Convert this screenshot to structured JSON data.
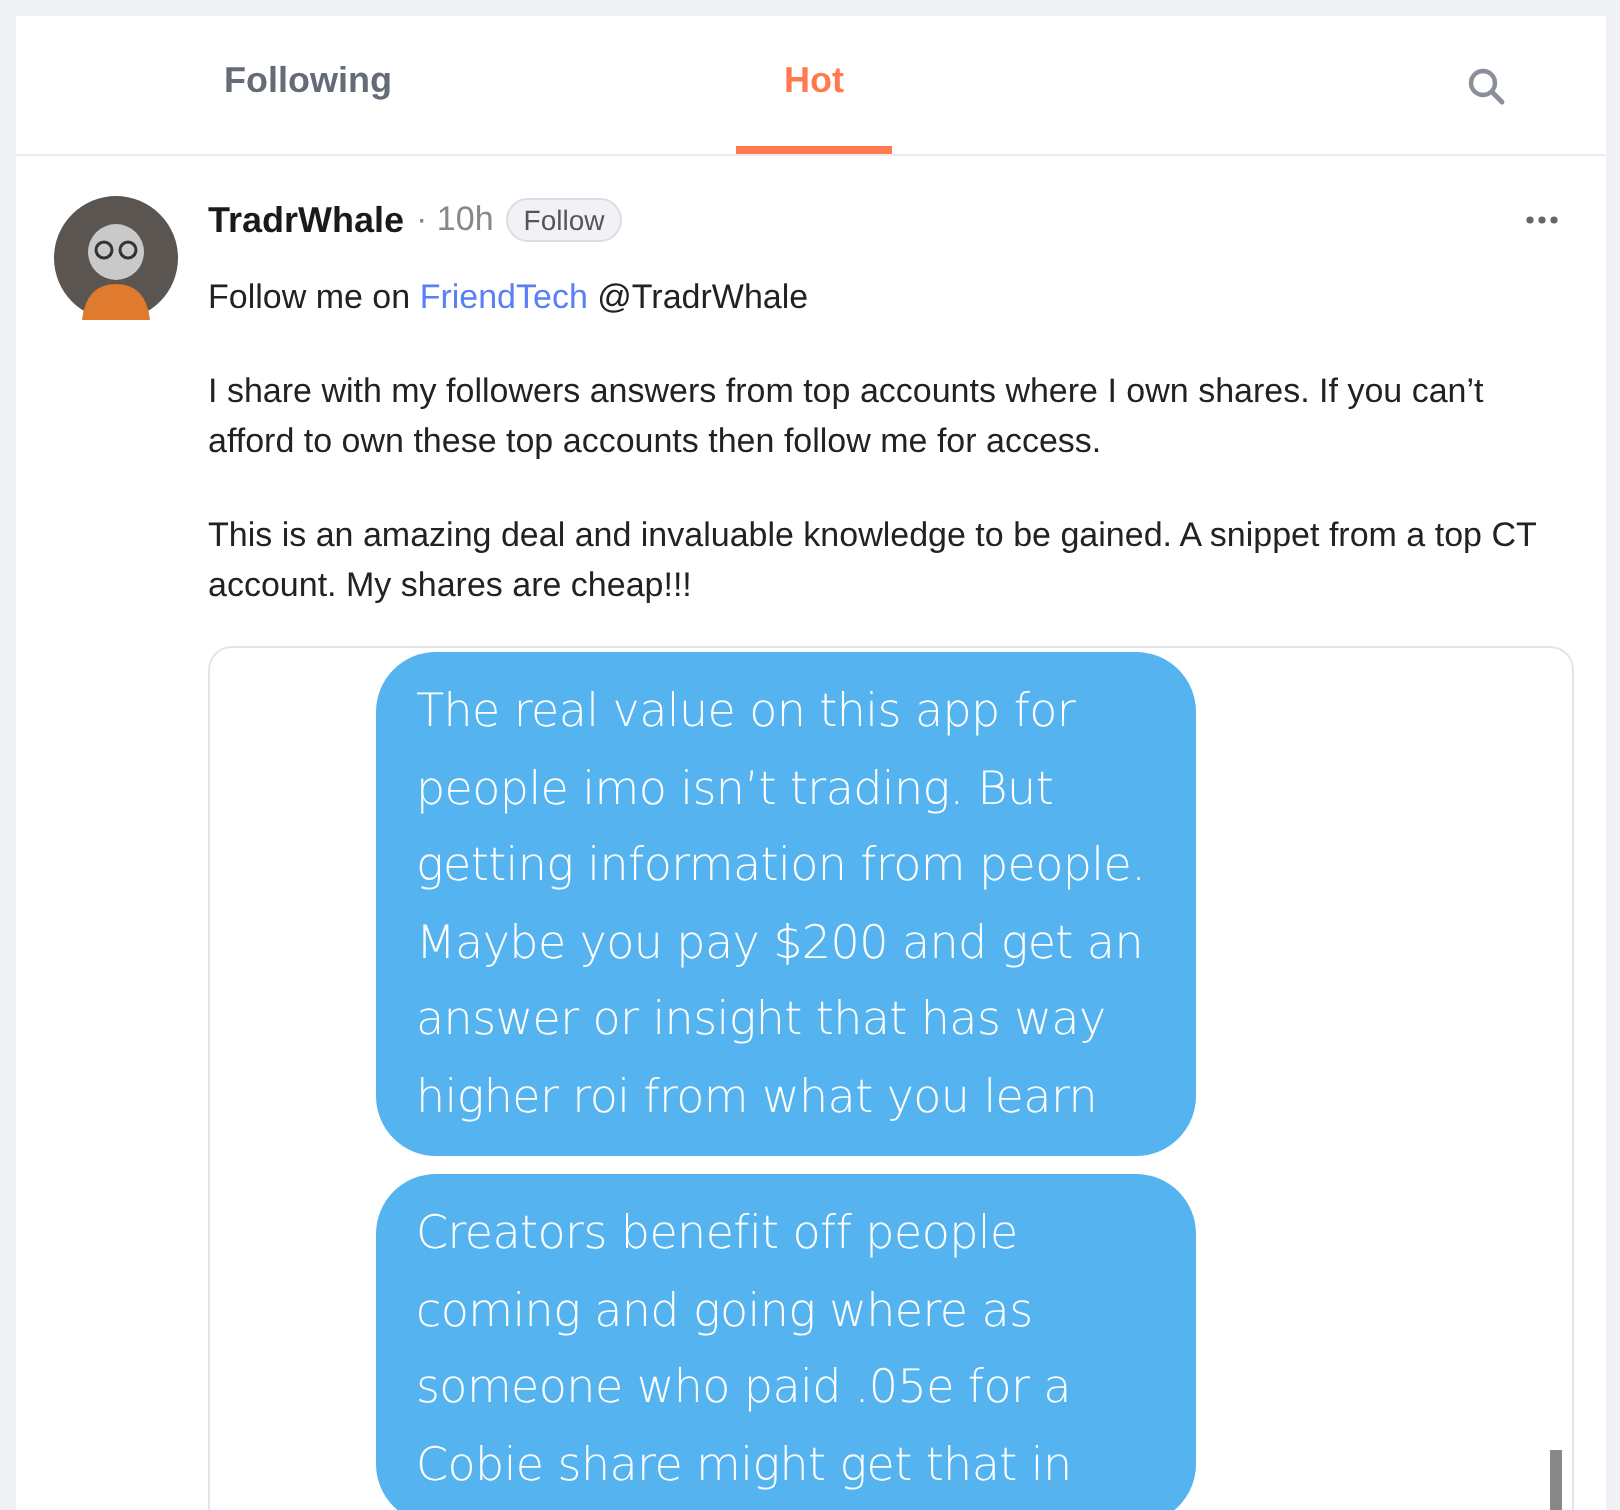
{
  "tabs": [
    {
      "label": "Following",
      "selected": false
    },
    {
      "label": "Hot",
      "selected": true
    }
  ],
  "post": {
    "author": "TradrWhale",
    "time": "· 10h",
    "follow_button": "Follow",
    "paragraphs": [
      [
        {
          "text": "Follow me on "
        },
        {
          "text": "FriendTech",
          "kind": "link"
        },
        {
          "text": " @TradrWhale"
        }
      ],
      [
        {
          "text": "I share with my followers answers from top accounts where I own shares. If you can’t afford to own these top accounts then follow me for access."
        }
      ],
      [
        {
          "text": "This is an amazing deal and invaluable knowledge to be gained. A snippet from a top CT account. My shares are cheap!!!"
        }
      ]
    ],
    "bubbles": [
      [
        "The real value on this app for",
        "people imo isn’t trading. But",
        "getting information from people.",
        "Maybe you pay $200 and get an",
        "answer or insight that has way",
        "higher roi from what you learn"
      ],
      [
        "Creators benefit off people",
        "coming and going where as",
        "someone who paid .05e for a",
        "Cobie share might get that in"
      ]
    ]
  }
}
